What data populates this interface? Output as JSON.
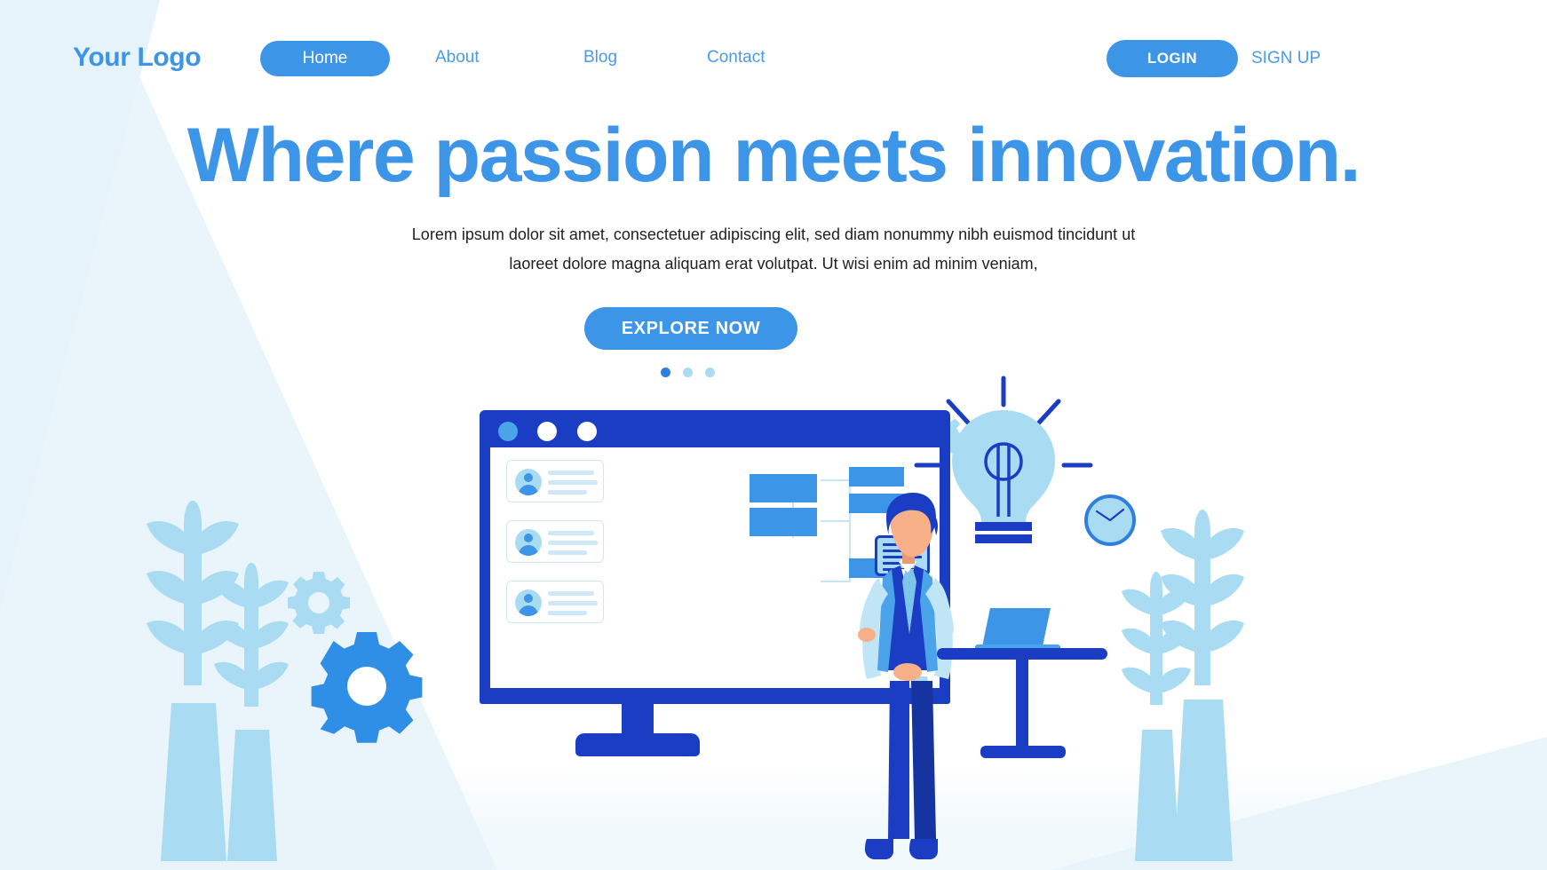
{
  "nav": {
    "logo": "Your Logo",
    "items": [
      {
        "label": "Home",
        "active": true
      },
      {
        "label": "About",
        "active": false
      },
      {
        "label": "Blog",
        "active": false
      },
      {
        "label": "Contact",
        "active": false
      }
    ],
    "login_label": "LOGIN",
    "signup_label": "SIGN UP"
  },
  "hero": {
    "headline": "Where passion meets innovation.",
    "paragraph_line1": "Lorem ipsum dolor sit amet, consectetuer adipiscing elit, sed diam nonummy nibh euismod tincidunt ut",
    "paragraph_line2": "laoreet dolore magna aliquam erat volutpat. Ut wisi enim ad minim veniam,",
    "cta_label": "EXPLORE NOW",
    "carousel": {
      "total": 3,
      "active_index": 0
    }
  },
  "illustration": {
    "window": {
      "title_dots": [
        "blue",
        "white",
        "white"
      ],
      "contact_cards": 3
    },
    "icons": [
      "monitor-window-icon",
      "gear-icon",
      "lightbulb-icon",
      "clock-icon",
      "laptop-icon",
      "desk-icon",
      "tablet-icon",
      "fern-plant-icon",
      "org-chart-icon",
      "woman-presenter-icon",
      "man-businessman-icon"
    ]
  },
  "colors": {
    "accent": "#3d95e8",
    "accent_dark": "#1a3dc4",
    "accent_mid": "#2f7fe0",
    "accent_light": "#a9dcf2",
    "accent_pale": "#cfe8f7",
    "bg_wedge": "#eaf5fb",
    "skin": "#f7b088",
    "white": "#ffffff",
    "text_dark": "#1f1f1f"
  }
}
